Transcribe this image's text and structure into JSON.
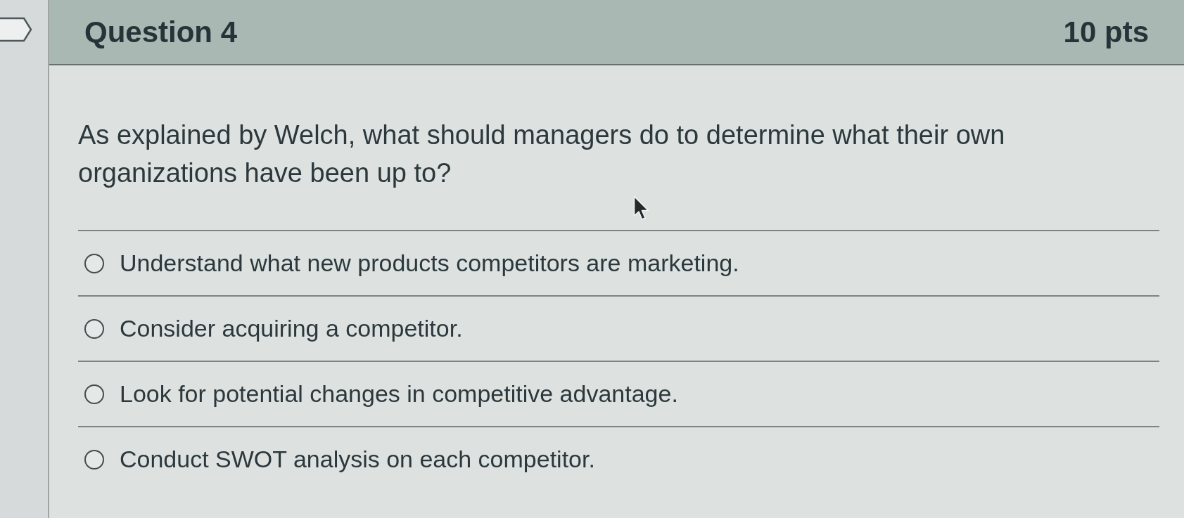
{
  "header": {
    "title": "Question 4",
    "points": "10 pts"
  },
  "question": {
    "text": "As explained by Welch, what should managers do to determine what their own organizations have been up to?"
  },
  "answers": [
    {
      "text": "Understand what new products competitors are marketing.",
      "selected": false
    },
    {
      "text": "Consider acquiring a competitor.",
      "selected": false
    },
    {
      "text": "Look for potential changes in competitive advantage.",
      "selected": false
    },
    {
      "text": "Conduct SWOT analysis on each competitor.",
      "selected": false
    }
  ]
}
